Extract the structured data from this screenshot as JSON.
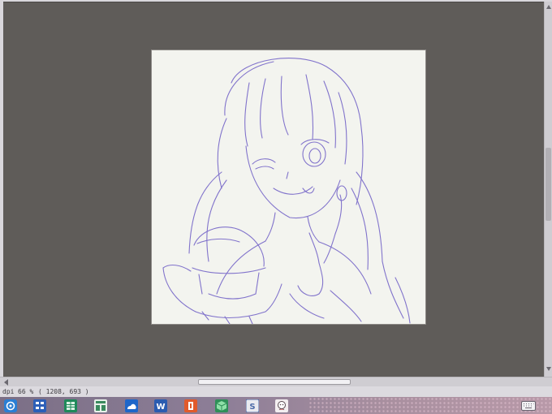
{
  "statusbar": {
    "unit": "dpi",
    "zoom": "66 %",
    "coords": "( 1208, 693 )"
  },
  "colors": {
    "workspace_bg": "#5f5c59",
    "canvas_bg": "#f3f4ef",
    "sketch_line": "#7566c8",
    "statusbar_bg": "#dcdadf",
    "taskbar_bg": "#8d7e97"
  },
  "taskbar": {
    "items": [
      {
        "icon": "browser-icon"
      },
      {
        "icon": "grid-app-icon"
      },
      {
        "icon": "spreadsheet-icon"
      },
      {
        "icon": "window-tiles-icon"
      },
      {
        "icon": "cloud-app-icon"
      },
      {
        "icon": "word-icon"
      },
      {
        "icon": "orange-app-icon"
      },
      {
        "icon": "cube-app-icon"
      },
      {
        "icon": "s-app-icon"
      },
      {
        "icon": "character-app-icon"
      }
    ],
    "tray": [
      {
        "icon": "keyboard-icon"
      }
    ]
  }
}
